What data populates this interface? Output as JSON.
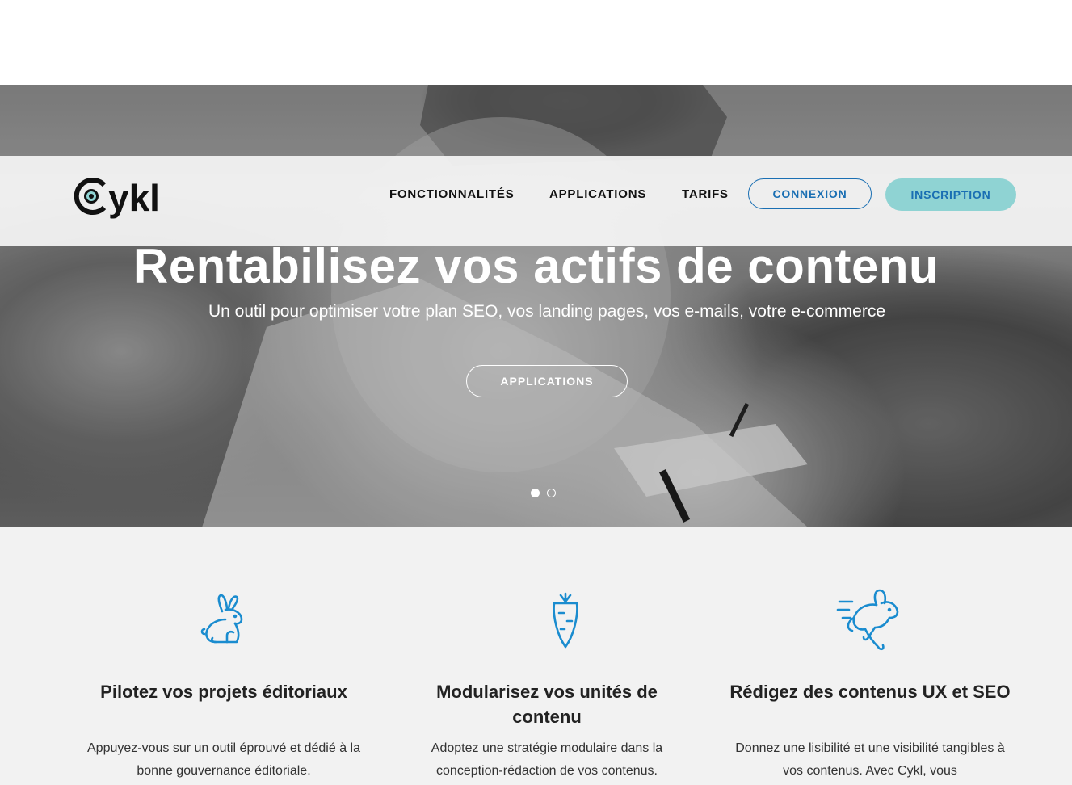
{
  "brand": {
    "name": "Cykl",
    "accent": "#1a6fb3",
    "accent_light": "#8fd3d3"
  },
  "nav": {
    "items": [
      "FONCTIONNALITÉS",
      "APPLICATIONS",
      "TARIFS"
    ],
    "connexion_label": "CONNEXION",
    "inscription_label": "INSCRIPTION"
  },
  "hero": {
    "title": "Rentabilisez vos actifs de contenu",
    "subtitle": "Un outil pour optimiser votre plan SEO, vos landing pages, vos e-mails, votre e-commerce",
    "button_label": "APPLICATIONS",
    "slides_total": 2,
    "slide_active": 1
  },
  "features": [
    {
      "icon": "rabbit-sitting-icon",
      "title": "Pilotez vos projets éditoriaux",
      "text": "Appuyez-vous sur un outil éprouvé et dédié à la bonne gouvernance éditoriale."
    },
    {
      "icon": "carrot-icon",
      "title": "Modularisez vos unités de contenu",
      "text": "Adoptez une stratégie modulaire dans la conception-rédaction de vos contenus."
    },
    {
      "icon": "rabbit-running-icon",
      "title": "Rédigez des contenus UX et SEO",
      "text": "Donnez une lisibilité et une visibilité tangibles à vos contenus. Avec Cykl, vous"
    }
  ]
}
